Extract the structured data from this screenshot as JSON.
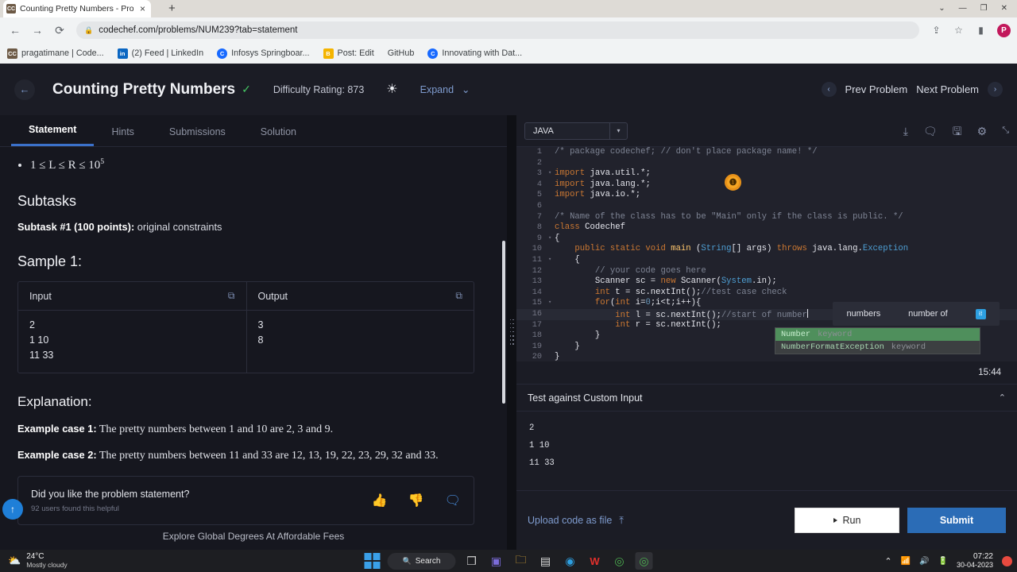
{
  "browser": {
    "tab": {
      "title": "Counting Pretty Numbers - Prob",
      "favicon_label": "CC",
      "close_icon": "×"
    },
    "new_tab_icon": "+",
    "window_controls": {
      "minimize": "—",
      "maximize": "❐",
      "close": "✕",
      "chevron": "⌄"
    },
    "nav": {
      "back": "←",
      "forward": "→",
      "reload": "⟳"
    },
    "omnibox": {
      "lock_icon": "🔒",
      "url": "codechef.com/problems/NUM239?tab=statement"
    },
    "toolbar_icons": {
      "share": "⇪",
      "bookmark_star": "☆",
      "sidepanel": "▮",
      "profile_initial": "P"
    },
    "bookmarks": [
      {
        "label": "pragatimane | Code...",
        "icon_text": "CC",
        "icon_color": "#6d5a46"
      },
      {
        "label": "(2) Feed | LinkedIn",
        "icon_text": "in",
        "icon_color": "#0a66c2"
      },
      {
        "label": "Infosys Springboar...",
        "icon_text": "C",
        "icon_color": "#1769ff"
      },
      {
        "label": "Post: Edit",
        "icon_text": "B",
        "icon_color": "#f4b400"
      },
      {
        "label": "GitHub",
        "icon_text": "",
        "icon_color": "transparent"
      },
      {
        "label": "Innovating with Dat...",
        "icon_text": "C",
        "icon_color": "#1769ff"
      }
    ]
  },
  "problem_header": {
    "back_icon": "←",
    "title": "Counting Pretty Numbers",
    "solved_check": "✓",
    "difficulty": "Difficulty Rating: 873",
    "brightness_icon": "☀",
    "expand_label": "Expand",
    "expand_caret": "⌄",
    "prev_label": "Prev Problem",
    "next_label": "Next Problem",
    "prev_icon": "‹",
    "next_icon": "›"
  },
  "tabs": [
    {
      "label": "Statement",
      "active": true
    },
    {
      "label": "Hints",
      "active": false
    },
    {
      "label": "Submissions",
      "active": false
    },
    {
      "label": "Solution",
      "active": false
    }
  ],
  "statement": {
    "constraint": "1 ≤ L ≤ R ≤ 10",
    "constraint_sup": "5",
    "subtasks_heading": "Subtasks",
    "subtask_bold": "Subtask #1 (100 points):",
    "subtask_rest": " original constraints",
    "sample_heading": "Sample 1:",
    "sample": {
      "input_header": "Input",
      "output_header": "Output",
      "copy_icon": "⧉",
      "input_lines": "2\n1 10\n11 33",
      "output_lines": "3\n8"
    },
    "explanation_heading": "Explanation:",
    "case1_bold": "Example case 1:",
    "case1_text": " The pretty numbers between 1 and 10 are 2, 3 and 9.",
    "case2_bold": "Example case 2:",
    "case2_text": " The pretty numbers between 11 and 33 are 12, 13, 19, 22, 23, 29, 32 and 33.",
    "feedback": {
      "question": "Did you like the problem statement?",
      "helpful": "92 users found this helpful",
      "thumbs_up": "👍",
      "thumbs_down": "👎",
      "comment": "🗨"
    },
    "scroll_top_icon": "↑",
    "ad_text": "Explore Global Degrees At Affordable Fees"
  },
  "editor": {
    "language": "JAVA",
    "lang_caret": "▾",
    "toolbar_icons": {
      "download": "⤓",
      "comment": "🗨",
      "save": "🖫",
      "settings": "⚙",
      "collapse": "⤡"
    },
    "code_lines": [
      {
        "n": 1,
        "fold": "",
        "segs": [
          {
            "t": "/* package codechef; // don't place package name! */",
            "c": "c-com"
          }
        ]
      },
      {
        "n": 2,
        "fold": "",
        "segs": []
      },
      {
        "n": 3,
        "fold": "▾",
        "segs": [
          {
            "t": "import ",
            "c": "c-kw"
          },
          {
            "t": "java.util.*;",
            "c": ""
          }
        ]
      },
      {
        "n": 4,
        "fold": "",
        "segs": [
          {
            "t": "import ",
            "c": "c-kw"
          },
          {
            "t": "java.lang.*;",
            "c": ""
          }
        ]
      },
      {
        "n": 5,
        "fold": "",
        "segs": [
          {
            "t": "import ",
            "c": "c-kw"
          },
          {
            "t": "java.io.*;",
            "c": ""
          }
        ]
      },
      {
        "n": 6,
        "fold": "",
        "segs": []
      },
      {
        "n": 7,
        "fold": "",
        "segs": [
          {
            "t": "/* Name of the class has to be \"Main\" only if the class is public. */",
            "c": "c-com"
          }
        ]
      },
      {
        "n": 8,
        "fold": "",
        "segs": [
          {
            "t": "class ",
            "c": "c-kw"
          },
          {
            "t": "Codechef",
            "c": ""
          }
        ]
      },
      {
        "n": 9,
        "fold": "▾",
        "segs": [
          {
            "t": "{",
            "c": ""
          }
        ]
      },
      {
        "n": 10,
        "fold": "",
        "segs": [
          {
            "t": "    public static void ",
            "c": "c-kw"
          },
          {
            "t": "main ",
            "c": "c-fn"
          },
          {
            "t": "(",
            "c": ""
          },
          {
            "t": "String",
            "c": "c-type"
          },
          {
            "t": "[] args) ",
            "c": ""
          },
          {
            "t": "throws ",
            "c": "c-kw"
          },
          {
            "t": "java.lang.",
            "c": ""
          },
          {
            "t": "Exception",
            "c": "c-type"
          }
        ]
      },
      {
        "n": 11,
        "fold": "▾",
        "segs": [
          {
            "t": "    {",
            "c": ""
          }
        ]
      },
      {
        "n": 12,
        "fold": "",
        "segs": [
          {
            "t": "        // your code goes here",
            "c": "c-com"
          }
        ]
      },
      {
        "n": 13,
        "fold": "",
        "segs": [
          {
            "t": "        Scanner sc = ",
            "c": ""
          },
          {
            "t": "new ",
            "c": "c-kw"
          },
          {
            "t": "Scanner(",
            "c": ""
          },
          {
            "t": "System",
            "c": "c-type"
          },
          {
            "t": ".in);",
            "c": ""
          }
        ]
      },
      {
        "n": 14,
        "fold": "",
        "segs": [
          {
            "t": "        ",
            "c": ""
          },
          {
            "t": "int ",
            "c": "c-kw"
          },
          {
            "t": "t = sc.nextInt();",
            "c": ""
          },
          {
            "t": "//test case check",
            "c": "c-com"
          }
        ]
      },
      {
        "n": 15,
        "fold": "▾",
        "segs": [
          {
            "t": "        ",
            "c": ""
          },
          {
            "t": "for",
            "c": "c-kw"
          },
          {
            "t": "(",
            "c": ""
          },
          {
            "t": "int ",
            "c": "c-kw"
          },
          {
            "t": "i=",
            "c": ""
          },
          {
            "t": "0",
            "c": "c-num"
          },
          {
            "t": ";i<t;i++){",
            "c": ""
          }
        ]
      },
      {
        "n": 16,
        "fold": "",
        "highlight": true,
        "caret": true,
        "segs": [
          {
            "t": "            ",
            "c": ""
          },
          {
            "t": "int ",
            "c": "c-kw"
          },
          {
            "t": "l = sc.nextInt();",
            "c": ""
          },
          {
            "t": "//start of number",
            "c": "c-com"
          }
        ]
      },
      {
        "n": 17,
        "fold": "",
        "segs": [
          {
            "t": "            ",
            "c": ""
          },
          {
            "t": "int ",
            "c": "c-kw"
          },
          {
            "t": "r = sc.nextInt();",
            "c": ""
          }
        ]
      },
      {
        "n": 18,
        "fold": "",
        "segs": [
          {
            "t": "        }",
            "c": ""
          }
        ]
      },
      {
        "n": 19,
        "fold": "",
        "segs": [
          {
            "t": "    }",
            "c": ""
          }
        ]
      },
      {
        "n": 20,
        "fold": "",
        "segs": [
          {
            "t": "}",
            "c": ""
          }
        ]
      }
    ],
    "error_marker": "❶",
    "autocomplete_hint": {
      "word1": "numbers",
      "word2": "number of",
      "icon": "⁝⁞"
    },
    "autocomplete_items": [
      {
        "name": "Number",
        "kind": "keyword",
        "selected": true
      },
      {
        "name": "NumberFormatException",
        "kind": "keyword",
        "selected": false
      }
    ],
    "timer": "15:44"
  },
  "custom_input": {
    "title": "Test against Custom Input",
    "collapse_icon": "⌃",
    "value": "2\n1 10\n11 33"
  },
  "actions": {
    "upload_label": "Upload code as file",
    "upload_icon": "⤒",
    "run_label": "Run",
    "submit_label": "Submit"
  },
  "taskbar": {
    "weather": {
      "icon": "⛅",
      "temp": "24°C",
      "condition": "Mostly cloudy"
    },
    "search_label": "Search",
    "search_icon": "🔍",
    "apps": [
      {
        "name": "task-view",
        "glyph": "❒",
        "color": "#cfcfcf",
        "active": false
      },
      {
        "name": "teams",
        "glyph": "▣",
        "color": "#7b6cd9",
        "active": false
      },
      {
        "name": "file-explorer",
        "glyph": "🗀",
        "color": "#f3b93b",
        "active": false
      },
      {
        "name": "microsoft-store",
        "glyph": "▤",
        "color": "#e0e0e0",
        "active": false
      },
      {
        "name": "edge",
        "glyph": "◉",
        "color": "#2d9fe0",
        "active": false
      },
      {
        "name": "wps-office",
        "glyph": "W",
        "color": "#e2302c",
        "active": false
      },
      {
        "name": "chrome",
        "glyph": "◎",
        "color": "#4caf50",
        "active": false
      },
      {
        "name": "chrome-profile",
        "glyph": "◎",
        "color": "#4caf50",
        "active": true
      }
    ],
    "tray": {
      "chevron": "⌃",
      "wifi": "📶",
      "volume": "🔊",
      "battery": "🔋"
    },
    "clock": {
      "time": "07:22",
      "date": "30-04-2023"
    }
  }
}
